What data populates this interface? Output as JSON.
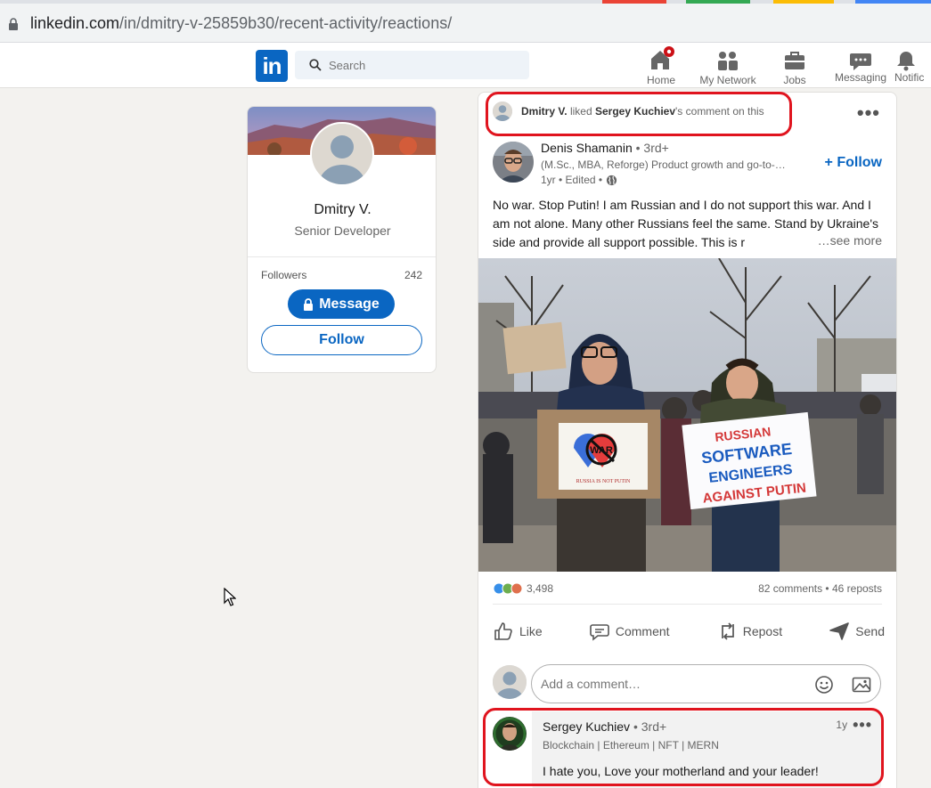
{
  "browser": {
    "url_host": "linkedin.com",
    "url_path": "/in/dmitry-v-25859b30/recent-activity/reactions/"
  },
  "header": {
    "logo": "in",
    "search_placeholder": "Search",
    "nav": [
      {
        "label": "Home",
        "icon": "home-icon"
      },
      {
        "label": "My Network",
        "icon": "network-icon"
      },
      {
        "label": "Jobs",
        "icon": "briefcase-icon"
      },
      {
        "label": "Messaging",
        "icon": "messaging-icon"
      },
      {
        "label": "Notific",
        "icon": "bell-icon"
      }
    ]
  },
  "profile": {
    "name": "Dmitry V.",
    "title": "Senior Developer",
    "followers_label": "Followers",
    "followers_count": "242",
    "message_label": "Message",
    "follow_label": "Follow"
  },
  "activity": {
    "actor": "Dmitry V.",
    "verb": "liked",
    "target": "Sergey Kuchiev",
    "suffix": "'s comment on this"
  },
  "post": {
    "author": "Denis Shamanin",
    "degree": "• 3rd+",
    "headline": "(M.Sc., MBA, Reforge) Product growth and go-to-…",
    "time": "1yr • Edited •",
    "follow": "+ Follow",
    "text": "No war. Stop Putin! I am Russian and I do not support this war. And I am not alone. Many other Russians feel the same. Stand by Ukraine's side and provide all support possible. This is r",
    "see_more": "…see more",
    "sign_left_main": "WAR",
    "sign_left_sub": "RUSSIA IS NOT PUTIN",
    "sign_right_lines": [
      "RUSSIAN",
      "SOFTWARE",
      "ENGINEERS",
      "AGAINST PUTIN"
    ],
    "reactions_count": "3,498",
    "counts": "82 comments • 46 reposts",
    "actions": [
      "Like",
      "Comment",
      "Repost",
      "Send"
    ]
  },
  "comment_input": {
    "placeholder": "Add a comment…"
  },
  "comment": {
    "author": "Sergey Kuchiev",
    "degree": "• 3rd+",
    "headline": "Blockchain | Ethereum | NFT | MERN",
    "time": "1y",
    "text": "I hate you, Love your motherland and your leader!"
  },
  "colors": {
    "brand": "#0a66c2",
    "highlight": "#e0141e",
    "notification": "#cc1016"
  }
}
